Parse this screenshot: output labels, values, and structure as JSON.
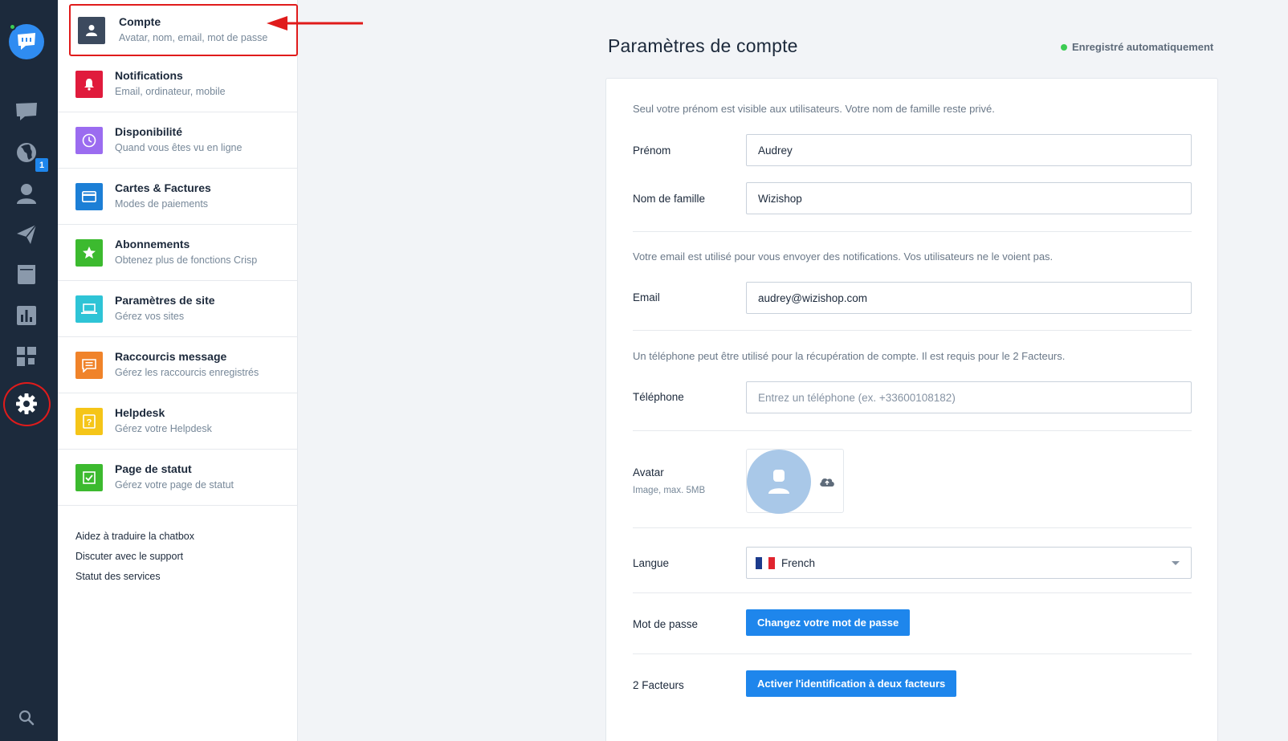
{
  "rail": {
    "badge_count": "1",
    "icons": [
      "chat-logo-icon",
      "conversations-icon",
      "visitors-globe-icon",
      "contacts-icon",
      "campaigns-icon",
      "helpdesk-icon",
      "analytics-icon",
      "plugins-icon",
      "settings-gear-icon",
      "search-icon"
    ]
  },
  "menu": {
    "active": {
      "title": "Compte",
      "subtitle": "Avatar, nom, email, mot de passe",
      "color": "#3c4a5e",
      "icon": "user-icon"
    },
    "items": [
      {
        "title": "Notifications",
        "subtitle": "Email, ordinateur, mobile",
        "color": "#e01b3c",
        "icon": "bell-icon"
      },
      {
        "title": "Disponibilité",
        "subtitle": "Quand vous êtes vu en ligne",
        "color": "#9b6cf0",
        "icon": "clock-icon"
      },
      {
        "title": "Cartes & Factures",
        "subtitle": "Modes de paiements",
        "color": "#1c7fd6",
        "icon": "credit-card-icon"
      },
      {
        "title": "Abonnements",
        "subtitle": "Obtenez plus de fonctions Crisp",
        "color": "#3cba2f",
        "icon": "star-icon"
      },
      {
        "title": "Paramètres de site",
        "subtitle": "Gérez vos sites",
        "color": "#2ec4d6",
        "icon": "laptop-icon"
      },
      {
        "title": "Raccourcis message",
        "subtitle": "Gérez les raccourcis enregistrés",
        "color": "#f0832a",
        "icon": "message-shortcut-icon"
      },
      {
        "title": "Helpdesk",
        "subtitle": "Gérez votre Helpdesk",
        "color": "#f5c518",
        "icon": "help-icon"
      },
      {
        "title": "Page de statut",
        "subtitle": "Gérez votre page de statut",
        "color": "#3cba2f",
        "icon": "check-icon"
      }
    ],
    "links": [
      "Aidez à traduire la chatbox",
      "Discuter avec le support",
      "Statut des services"
    ]
  },
  "main": {
    "title": "Paramètres de compte",
    "saved_status": "Enregistré automatiquement",
    "name_note": "Seul votre prénom est visible aux utilisateurs. Votre nom de famille reste privé.",
    "first_name_label": "Prénom",
    "first_name_value": "Audrey",
    "last_name_label": "Nom de famille",
    "last_name_value": "Wizishop",
    "email_note": "Votre email est utilisé pour vous envoyer des notifications. Vos utilisateurs ne le voient pas.",
    "email_label": "Email",
    "email_value": "audrey@wizishop.com",
    "phone_note": "Un téléphone peut être utilisé pour la récupération de compte. Il est requis pour le 2 Facteurs.",
    "phone_label": "Téléphone",
    "phone_placeholder": "Entrez un téléphone (ex. +33600108182)",
    "avatar_label": "Avatar",
    "avatar_sub": "Image, max. 5MB",
    "language_label": "Langue",
    "language_value": "French",
    "password_label": "Mot de passe",
    "password_button": "Changez votre mot de passe",
    "twofa_label": "2 Facteurs",
    "twofa_button": "Activer l'identification à deux facteurs"
  },
  "colors": {
    "accent": "#1e86ec",
    "rail_bg": "#1c2a3c",
    "annotation": "#e01b1b",
    "online": "#3ccc53"
  }
}
